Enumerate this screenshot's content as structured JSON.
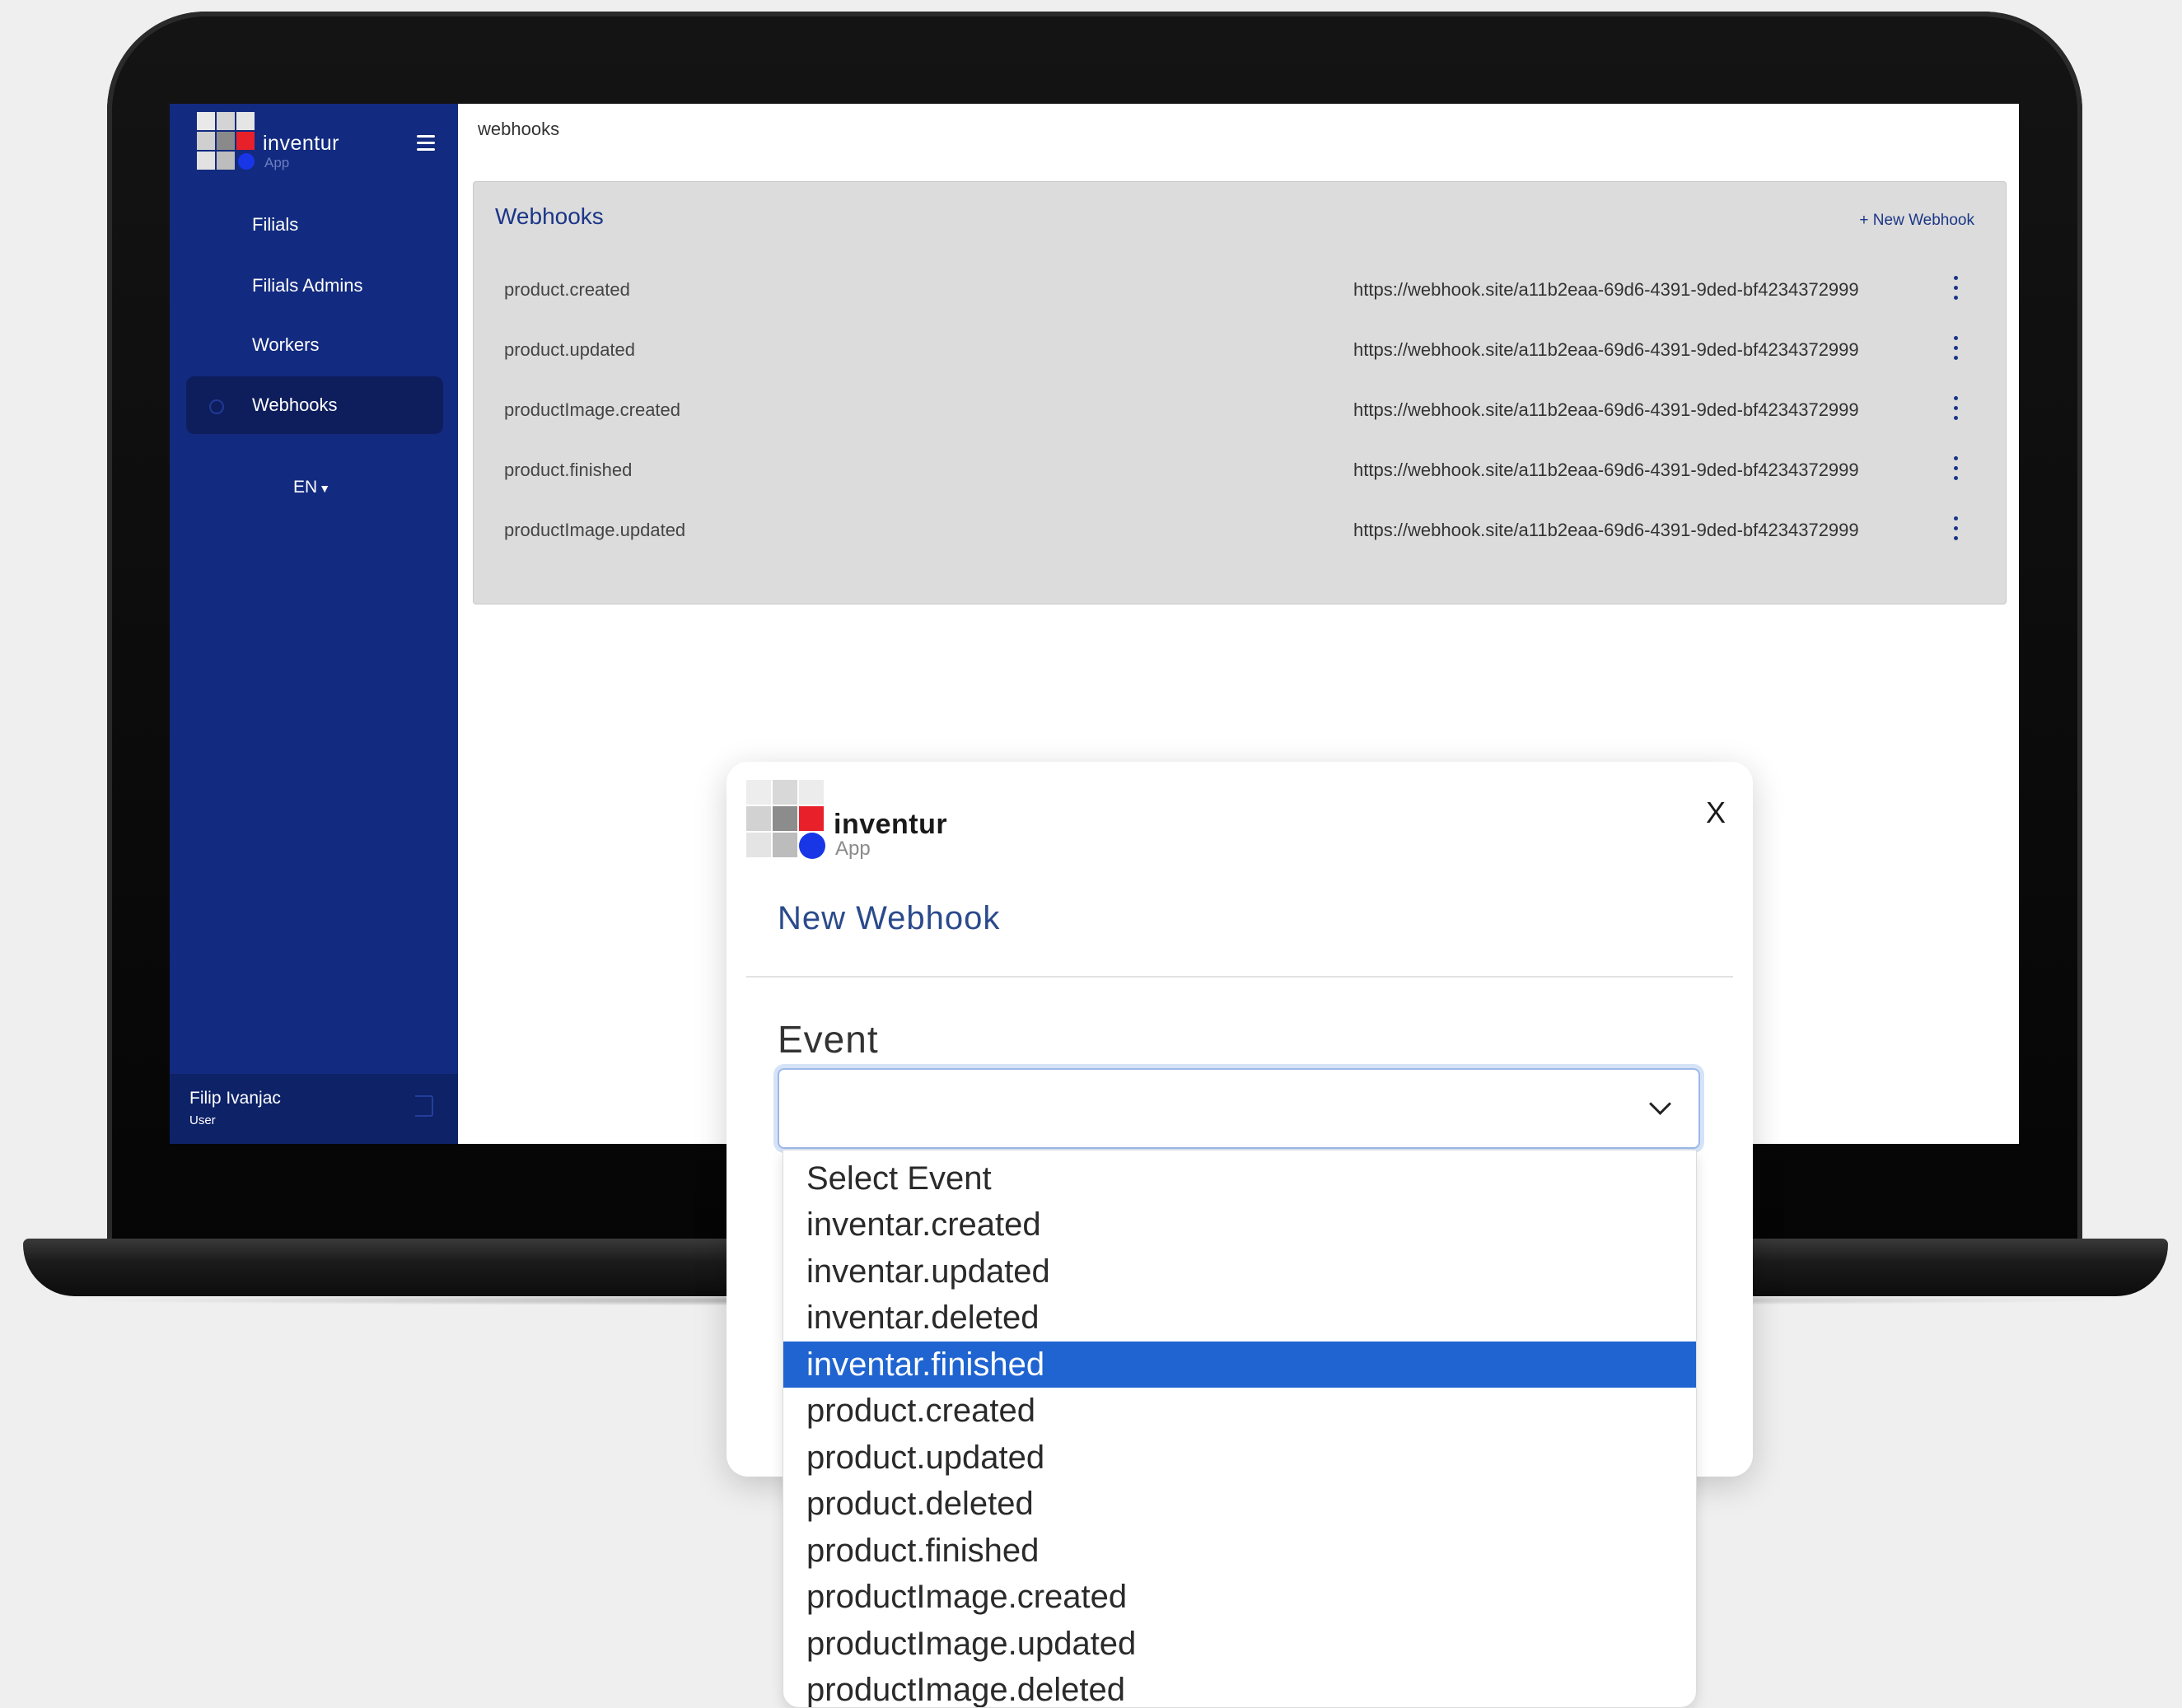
{
  "app": {
    "brand_name": "inventur",
    "brand_sub": "App"
  },
  "sidebar": {
    "items": [
      {
        "label": "Filials"
      },
      {
        "label": "Filials Admins"
      },
      {
        "label": "Workers"
      },
      {
        "label": "Webhooks",
        "active": true
      }
    ],
    "language": "EN",
    "user": {
      "name": "Filip Ivanjac",
      "role": "User"
    }
  },
  "breadcrumb": "webhooks",
  "webhooks_panel": {
    "title": "Webhooks",
    "new_button": "+ New Webhook",
    "rows": [
      {
        "event": "product.created",
        "url": "https://webhook.site/a11b2eaa-69d6-4391-9ded-bf4234372999"
      },
      {
        "event": "product.updated",
        "url": "https://webhook.site/a11b2eaa-69d6-4391-9ded-bf4234372999"
      },
      {
        "event": "productImage.created",
        "url": "https://webhook.site/a11b2eaa-69d6-4391-9ded-bf4234372999"
      },
      {
        "event": "product.finished",
        "url": "https://webhook.site/a11b2eaa-69d6-4391-9ded-bf4234372999"
      },
      {
        "event": "productImage.updated",
        "url": "https://webhook.site/a11b2eaa-69d6-4391-9ded-bf4234372999"
      }
    ]
  },
  "modal": {
    "brand_name": "inventur",
    "brand_sub": "App",
    "close_label": "X",
    "title": "New Webhook",
    "event_label": "Event",
    "event_value": "",
    "options": [
      "Select Event",
      "inventar.created",
      "inventar.updated",
      "inventar.deleted",
      "inventar.finished",
      "product.created",
      "product.updated",
      "product.deleted",
      "product.finished",
      "productImage.created",
      "productImage.updated",
      "productImage.deleted"
    ],
    "highlighted_option": "inventar.finished"
  },
  "colors": {
    "sidebar": "#122a7f",
    "accent": "#1b3687",
    "highlight": "#1f64d0",
    "logo_red": "#e8202a",
    "logo_blue": "#1836e6"
  }
}
